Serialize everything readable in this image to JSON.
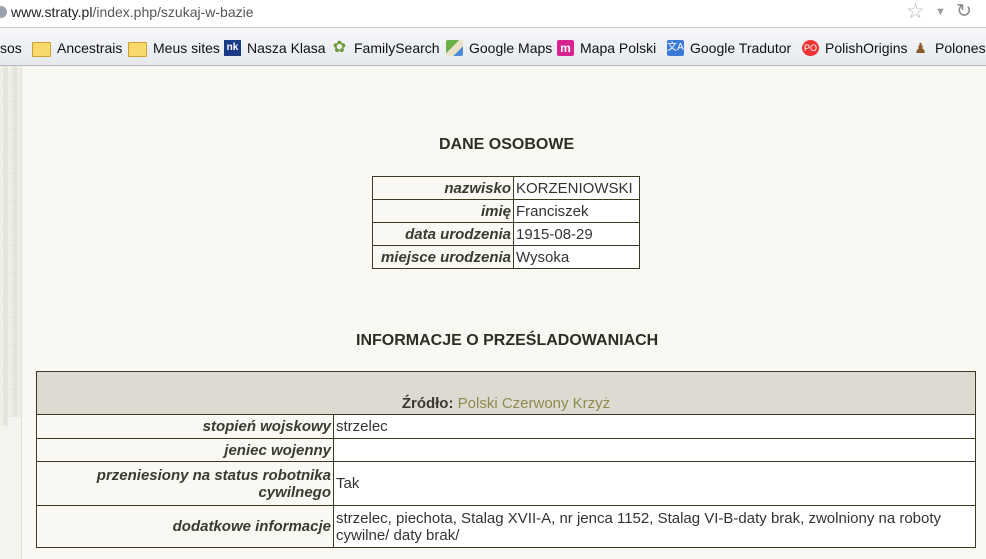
{
  "address_bar": {
    "domain": "www.straty.pl",
    "path": "/index.php/szukaj-w-bazie"
  },
  "bookmarks": [
    {
      "label": "sos",
      "icon": "none"
    },
    {
      "label": "Ancestrais",
      "icon": "folder-icon"
    },
    {
      "label": "Meus sites",
      "icon": "folder-icon"
    },
    {
      "label": "Nasza Klasa",
      "icon": "nasza-klasa-icon"
    },
    {
      "label": "FamilySearch",
      "icon": "familysearch-icon"
    },
    {
      "label": "Google Maps",
      "icon": "google-maps-icon"
    },
    {
      "label": "Mapa Polski",
      "icon": "mapa-polski-icon"
    },
    {
      "label": "Google Tradutor",
      "icon": "google-translate-icon"
    },
    {
      "label": "PolishOrigins",
      "icon": "polishorigins-icon"
    },
    {
      "label": "Polonese",
      "icon": "polonese-icon"
    }
  ],
  "personal": {
    "title": "DANE OSOBOWE",
    "rows": [
      {
        "label": "nazwisko",
        "value": "KORZENIOWSKI"
      },
      {
        "label": "imię",
        "value": "Franciszek"
      },
      {
        "label": "data urodzenia",
        "value": "1915-08-29"
      },
      {
        "label": "miejsce urodzenia",
        "value": "Wysoka"
      }
    ]
  },
  "persecution": {
    "title": "INFORMACJE O PRZEŚLADOWANIACH",
    "source_label": "Źródło:",
    "source_value": "Polski Czerwony Krzyż",
    "rows": [
      {
        "label": "stopień wojskowy",
        "value": "strzelec"
      },
      {
        "label": "jeniec wojenny",
        "value": ""
      },
      {
        "label": "przeniesiony na status robotnika cywilnego",
        "value": "Tak"
      },
      {
        "label": "dodatkowe informacje",
        "value": "strzelec, piechota, Stalag XVII-A, nr jenca 1152, Stalag VI-B-daty brak, zwolniony na roboty cywilne/ daty brak/"
      }
    ]
  }
}
